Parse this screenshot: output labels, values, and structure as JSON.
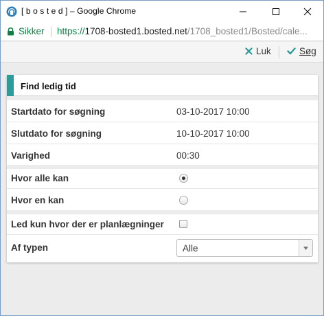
{
  "window": {
    "title": "[ b o s t e d ] – Google Chrome"
  },
  "address_bar": {
    "security_label": "Sikker",
    "url_scheme": "https://",
    "url_host": "1708-bosted1.bosted.net",
    "url_path": "/1708_bosted1/Bosted/cale..."
  },
  "toolbar": {
    "close_label": "Luk",
    "search_label": "Søg"
  },
  "panel": {
    "title": "Find ledig tid",
    "rows": {
      "start": {
        "label": "Startdato for søgning",
        "value": "03-10-2017 10:00"
      },
      "end": {
        "label": "Slutdato for søgning",
        "value": "10-10-2017 10:00"
      },
      "duration": {
        "label": "Varighed",
        "value": "00:30"
      },
      "all_can": {
        "label": "Hvor alle kan",
        "checked": true
      },
      "one_can": {
        "label": "Hvor en kan",
        "checked": false
      },
      "only_planned": {
        "label": "Led kun hvor der er planlægninger",
        "checked": false
      },
      "type": {
        "label": "Af typen",
        "selected": "Alle"
      }
    }
  },
  "colors": {
    "accent": "#2e9b98",
    "secure_green": "#0b8043",
    "background": "#ececec"
  },
  "icons": [
    "chrome-app-icon",
    "lock-icon",
    "close-x-icon",
    "checkmark-icon",
    "dropdown-arrow-icon"
  ]
}
